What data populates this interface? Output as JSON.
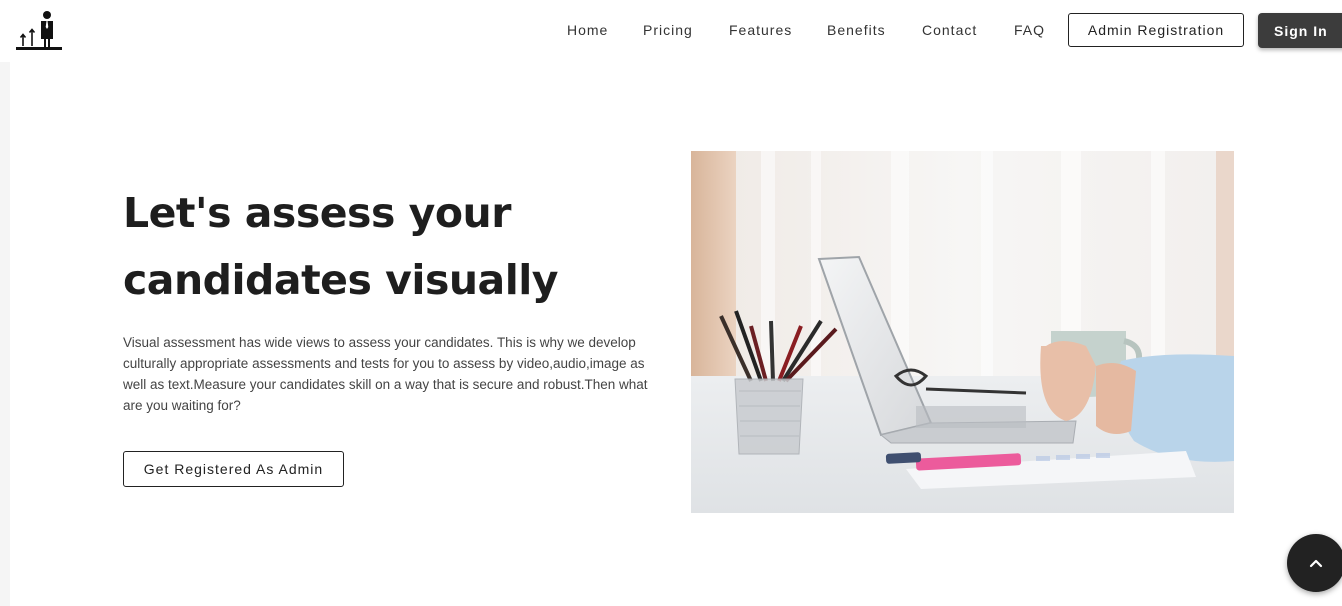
{
  "nav": {
    "home": "Home",
    "pricing": "Pricing",
    "features": "Features",
    "benefits": "Benefits",
    "contact": "Contact",
    "faq": "FAQ",
    "admin_registration": "Admin Registration",
    "sign_in": "Sign In"
  },
  "hero": {
    "title_line1": "Let's assess your",
    "title_line2": "candidates visually",
    "description": "Visual assessment has wide views to assess your candidates. This is why we develop culturally appropriate assessments and tests for you to assess by video,audio,image as well as text.Measure your candidates skill on a way that is secure and robust.Then what are you waiting for?",
    "cta_label": "Get Registered As Admin"
  },
  "icons": {
    "logo": "person-podium-growth-logo",
    "scroll_top": "chevron-up-icon",
    "hero_image": "laptop-desk-coffee-pencils-photo"
  },
  "colors": {
    "primary_dark": "#3c3c3c",
    "text": "#1e1e1e",
    "background": "#ffffff"
  }
}
